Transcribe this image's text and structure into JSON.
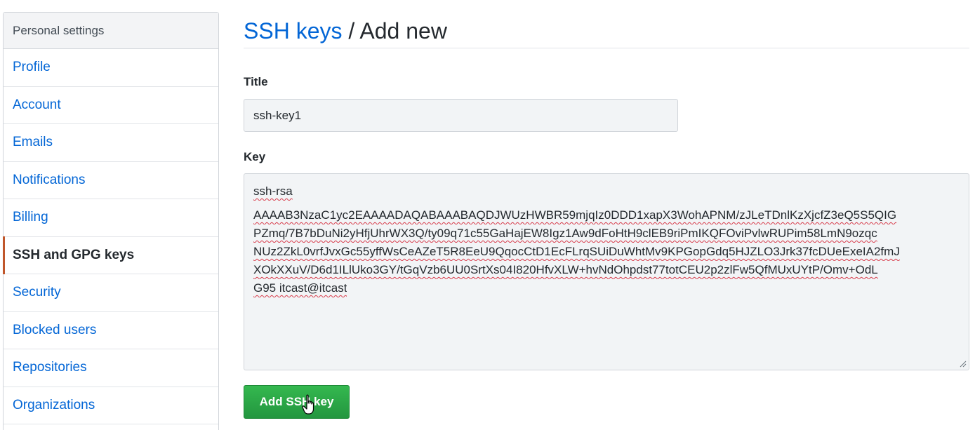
{
  "sidebar": {
    "header": "Personal settings",
    "items": [
      {
        "label": "Profile"
      },
      {
        "label": "Account"
      },
      {
        "label": "Emails"
      },
      {
        "label": "Notifications"
      },
      {
        "label": "Billing"
      },
      {
        "label": "SSH and GPG keys",
        "selected": true
      },
      {
        "label": "Security"
      },
      {
        "label": "Blocked users"
      },
      {
        "label": "Repositories"
      },
      {
        "label": "Organizations"
      }
    ]
  },
  "main": {
    "heading_link": "SSH keys",
    "heading_separator": " / ",
    "heading_current": "Add new",
    "title_label": "Title",
    "title_value": "ssh-key1",
    "key_label": "Key",
    "key_lines": [
      "ssh-rsa",
      "AAAAB3NzaC1yc2EAAAADAQABAAABAQDJWUzHWBR59mjqIz0DDD1xapX3WohAPNM/zJLeTDnlKzXjcfZ3eQ5S5QIG",
      "PZmq/7B7bDuNi2yHfjUhrWX3Q/ty09q71c55GaHajEW8Igz1Aw9dFoHtH9clEB9riPmIKQFOviPvlwRUPim58LmN9ozqc",
      "NUz2ZkL0vrfJvxGc55yffWsCeAZeT5R8EeU9QqocCtD1EcFLrqSUiDuWhtMv9KPGopGdq5HJZLO3Jrk37fcDUeExeIA2fmJ",
      "XOkXXuV/D6d1ILlUko3GY/tGqVzb6UU0SrtXs04I820HfvXLW+hvNdOhpdst77totCEU2p2zlFw5QfMUxUYtP/Omv+OdL",
      "G95 itcast@itcast"
    ],
    "submit_label": "Add SSH key"
  },
  "colors": {
    "link": "#0366d6",
    "selected_indicator": "#c0562b",
    "primary_button": "#28a745",
    "spellcheck_underline": "#d73a49"
  }
}
